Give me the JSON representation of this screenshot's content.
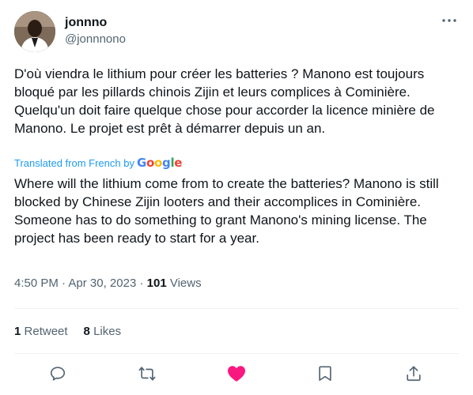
{
  "author": {
    "display_name": "jonnno",
    "handle": "@jonnnono"
  },
  "tweet": {
    "original_text": "D'où viendra le lithium pour créer les batteries ? Manono est toujours bloqué par les pillards chinois Zijin et leurs complices à Cominière. Quelqu'un doit faire quelque chose pour accorder la licence minière de Manono. Le projet est prêt à démarrer depuis un an.",
    "translated_from": "Translated from French by",
    "translator_logo": "Google",
    "translated_text": "Where will the lithium come from to create the batteries? Manono is still blocked by Chinese Zijin looters and their accomplices in Cominière. Someone has to do something to grant Manono's mining license. The project has been ready to start for a year."
  },
  "meta": {
    "time": "4:50 PM",
    "separator": "·",
    "date": "Apr 30, 2023",
    "views_count": "101",
    "views_label": "Views"
  },
  "stats": {
    "retweets_count": "1",
    "retweets_label": "Retweet",
    "likes_count": "8",
    "likes_label": "Likes"
  },
  "colors": {
    "text": "#0f1419",
    "secondary": "#536471",
    "link": "#1d9bf0",
    "like": "#f91880",
    "divider": "#eff3f4"
  },
  "icons": {
    "more": "more-dots-icon",
    "reply": "reply-icon",
    "retweet": "retweet-icon",
    "like": "heart-filled-icon",
    "bookmark": "bookmark-icon",
    "share": "share-icon"
  }
}
